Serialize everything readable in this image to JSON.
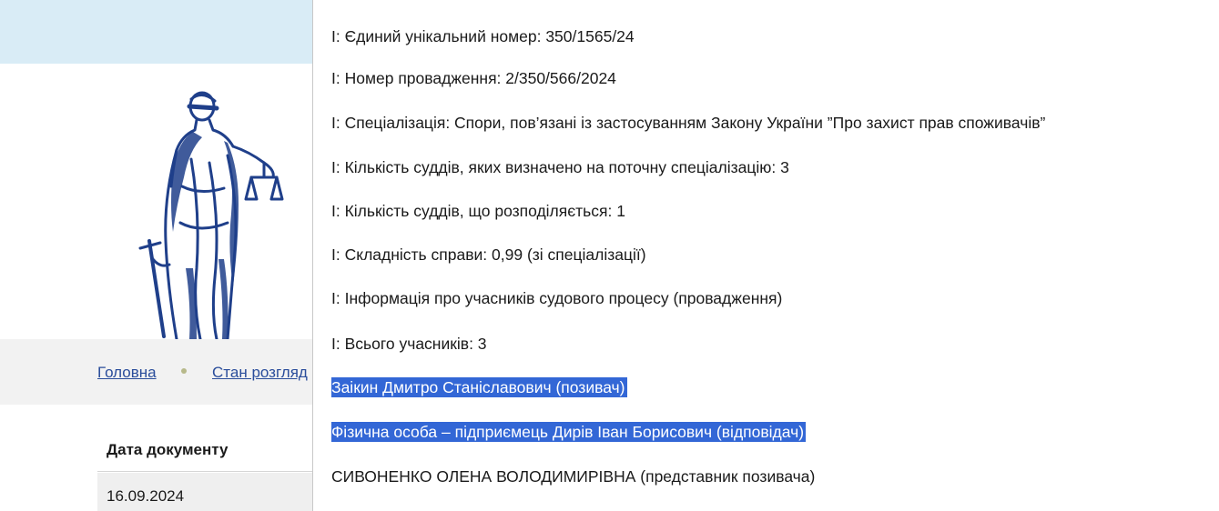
{
  "breadcrumb": {
    "home": "Головна",
    "state": "Стан розгляд"
  },
  "table": {
    "header_date": "Дата документу",
    "row_date": "16.09.2024"
  },
  "details": {
    "lines": [
      "І: Єдиний унікальний номер: 350/1565/24",
      "І: Номер провадження: 2/350/566/2024",
      "І: Спеціалізація: Спори, пов’язані із застосуванням Закону України ”Про захист прав споживачів”",
      "І: Кількість суддів, яких визначено на поточну спеціалізацію: 3",
      "І: Кількість суддів, що розподіляється: 1",
      "І: Складність справи: 0,99 (зі спеціалізації)",
      "І: Інформація про учасників судового процесу (провадження)",
      "І: Всього учасників: 3"
    ],
    "participants": [
      "Заікин Дмитро Станіславович (позивач)",
      "Фізична особа – підприємець Дирів Іван Борисович (відповідач)",
      "СИВОНЕНКО ОЛЕНА ВОЛОДИМИРІВНА (представник позивача)"
    ]
  },
  "colors": {
    "selection": "#3367d6",
    "link": "#2a4d9b",
    "logo": "#1f3f8a",
    "top_band": "#d9ecf6"
  },
  "icons": {
    "logo": "themis-justice-statue-icon"
  }
}
